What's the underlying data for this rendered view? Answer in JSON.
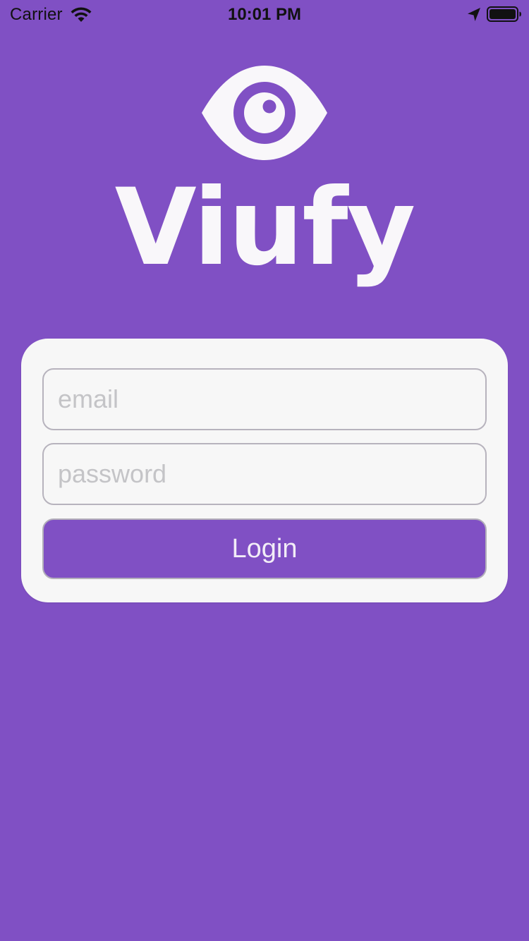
{
  "status_bar": {
    "carrier": "Carrier",
    "time": "10:01 PM",
    "icons": [
      "wifi-icon",
      "location-arrow-icon",
      "battery-icon"
    ]
  },
  "brand": {
    "name": "Viufy",
    "logo_icon": "eye-icon",
    "background_color": "#8050C4",
    "logo_color": "#F9F7FA"
  },
  "login_form": {
    "email_placeholder": "email",
    "email_value": "",
    "password_placeholder": "password",
    "password_value": "",
    "login_label": "Login",
    "card_color": "#F7F7F7",
    "button_color": "#8050C4"
  }
}
